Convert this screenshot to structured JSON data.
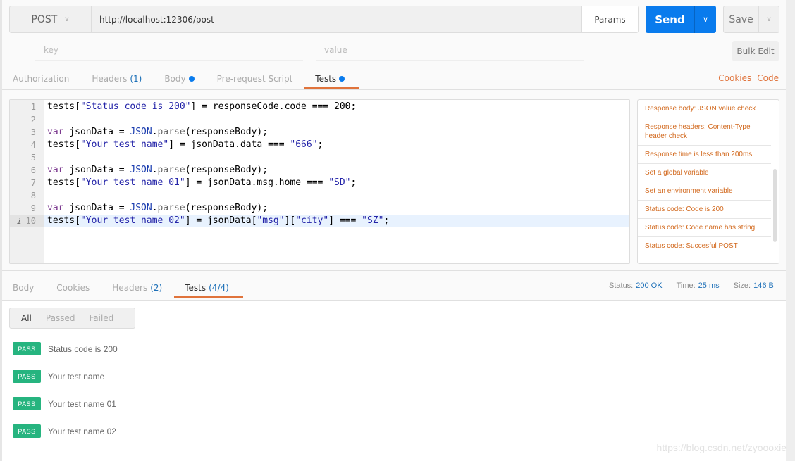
{
  "request": {
    "method": "POST",
    "url": "http://localhost:12306/post",
    "params_label": "Params",
    "send_label": "Send",
    "save_label": "Save"
  },
  "params_row": {
    "key_placeholder": "key",
    "value_placeholder": "value",
    "bulk_edit_label": "Bulk Edit"
  },
  "request_tabs": [
    {
      "label": "Authorization"
    },
    {
      "label": "Headers",
      "count": "(1)"
    },
    {
      "label": "Body",
      "dot": true
    },
    {
      "label": "Pre-request Script"
    },
    {
      "label": "Tests",
      "dot": true,
      "active": true
    }
  ],
  "links": {
    "cookies": "Cookies",
    "code": "Code"
  },
  "code": {
    "lines": [
      [
        [
          "tests[",
          "p"
        ],
        [
          "\"Status code is 200\"",
          "s"
        ],
        [
          "] = responseCode.code === 200;",
          "p"
        ]
      ],
      [],
      [
        [
          "var",
          "k"
        ],
        [
          " jsonData = ",
          "p"
        ],
        [
          "JSON",
          "c"
        ],
        [
          ".",
          "p"
        ],
        [
          "parse",
          "f"
        ],
        [
          "(responseBody);",
          "p"
        ]
      ],
      [
        [
          "tests[",
          "p"
        ],
        [
          "\"Your test name\"",
          "s"
        ],
        [
          "] = jsonData.data === ",
          "p"
        ],
        [
          "\"666\"",
          "s"
        ],
        [
          ";",
          "p"
        ]
      ],
      [],
      [
        [
          "var",
          "k"
        ],
        [
          " jsonData = ",
          "p"
        ],
        [
          "JSON",
          "c"
        ],
        [
          ".",
          "p"
        ],
        [
          "parse",
          "f"
        ],
        [
          "(responseBody);",
          "p"
        ]
      ],
      [
        [
          "tests[",
          "p"
        ],
        [
          "\"Your test name 01\"",
          "s"
        ],
        [
          "] = jsonData.msg.home === ",
          "p"
        ],
        [
          "\"SD\"",
          "s"
        ],
        [
          ";",
          "p"
        ]
      ],
      [],
      [
        [
          "var",
          "k"
        ],
        [
          " jsonData = ",
          "p"
        ],
        [
          "JSON",
          "c"
        ],
        [
          ".",
          "p"
        ],
        [
          "parse",
          "f"
        ],
        [
          "(responseBody);",
          "p"
        ]
      ],
      [
        [
          "tests[",
          "p"
        ],
        [
          "\"Your test name 02\"",
          "s"
        ],
        [
          "] = jsonData[",
          "p"
        ],
        [
          "\"msg\"",
          "s"
        ],
        [
          "][",
          "p"
        ],
        [
          "\"city\"",
          "s"
        ],
        [
          "] === ",
          "p"
        ],
        [
          "\"SZ\"",
          "s"
        ],
        [
          ";",
          "p"
        ]
      ]
    ],
    "current_line": 10,
    "info_marker": "i"
  },
  "snippets": [
    "Response body: JSON value check",
    "Response headers: Content-Type header check",
    "Response time is less than 200ms",
    "Set a global variable",
    "Set an environment variable",
    "Status code: Code is 200",
    "Status code: Code name has string",
    "Status code: Succesful POST"
  ],
  "response_tabs": [
    {
      "label": "Body"
    },
    {
      "label": "Cookies"
    },
    {
      "label": "Headers",
      "count": "(2)"
    },
    {
      "label": "Tests",
      "count": "(4/4)",
      "active": true
    }
  ],
  "status": {
    "status_label": "Status:",
    "status_value": "200 OK",
    "time_label": "Time:",
    "time_value": "25 ms",
    "size_label": "Size:",
    "size_value": "146 B"
  },
  "filters": [
    {
      "label": "All",
      "active": true
    },
    {
      "label": "Passed"
    },
    {
      "label": "Failed"
    }
  ],
  "results": [
    {
      "badge": "PASS",
      "name": "Status code is 200"
    },
    {
      "badge": "PASS",
      "name": "Your test name"
    },
    {
      "badge": "PASS",
      "name": "Your test name 01"
    },
    {
      "badge": "PASS",
      "name": "Your test name 02"
    }
  ],
  "watermark": "https://blog.csdn.net/zyoooxie",
  "colors": {
    "accent": "#097bed",
    "tab_underline": "#e0733b",
    "pass": "#26b47f",
    "snippet_text": "#d2691e"
  }
}
